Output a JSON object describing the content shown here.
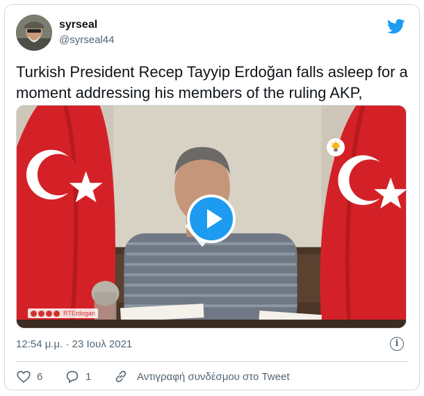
{
  "user": {
    "name": "syrseal",
    "handle": "@syrseal44"
  },
  "tweet": {
    "text": "Turkish President Recep Tayyip Erdoğan falls asleep for a moment addressing his members of the ruling AKP,",
    "timestamp": "12:54 μ.μ. · 23 Ιουλ 2021"
  },
  "video": {
    "watermark_text": "RTErdogan",
    "play_icon": "play-icon",
    "logo_icon": "lightbulb-icon"
  },
  "actions": {
    "like_count": "6",
    "reply_count": "1",
    "copy_link_label": "Αντιγραφή συνδέσμου στο Tweet"
  },
  "colors": {
    "accent": "#1d9bf0",
    "secondary_text": "#536471",
    "flag_red": "#d42127"
  }
}
